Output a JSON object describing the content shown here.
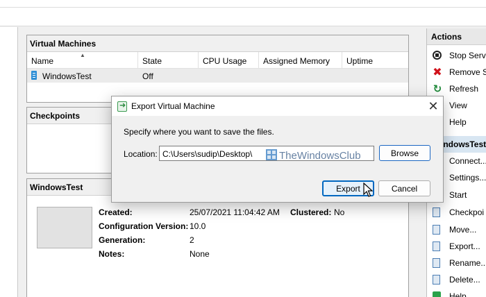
{
  "vm_panel": {
    "title": "Virtual Machines",
    "columns": [
      "Name",
      "State",
      "CPU Usage",
      "Assigned Memory",
      "Uptime"
    ],
    "rows": [
      {
        "name": "WindowsTest",
        "state": "Off",
        "cpu": "",
        "memory": "",
        "uptime": ""
      }
    ]
  },
  "checkpoints_panel": {
    "title": "Checkpoints"
  },
  "details_panel": {
    "title": "WindowsTest",
    "fields": [
      {
        "label": "Created:",
        "value": "25/07/2021 11:04:42 AM"
      },
      {
        "label": "Configuration Version:",
        "value": "10.0"
      },
      {
        "label": "Generation:",
        "value": "2"
      },
      {
        "label": "Notes:",
        "value": "None"
      }
    ],
    "clustered": {
      "label": "Clustered:",
      "value": "No"
    }
  },
  "actions": {
    "title": "Actions",
    "items": [
      {
        "label": "Stop Servi",
        "icon": "stop-service-icon"
      },
      {
        "label": "Remove S",
        "icon": "remove-icon"
      },
      {
        "label": "Refresh",
        "icon": "refresh-icon"
      },
      {
        "label": "View",
        "icon": ""
      },
      {
        "label": "Help",
        "icon": ""
      }
    ],
    "vm_section": "indowsTest",
    "vm_items": [
      {
        "label": "Connect...",
        "icon": ""
      },
      {
        "label": "Settings...",
        "icon": ""
      },
      {
        "label": "Start",
        "icon": ""
      },
      {
        "label": "Checkpoi",
        "icon": "checkpoint-icon"
      },
      {
        "label": "Move...",
        "icon": "move-icon"
      },
      {
        "label": "Export...",
        "icon": "export-icon"
      },
      {
        "label": "Rename...",
        "icon": "rename-icon"
      },
      {
        "label": "Delete...",
        "icon": "delete-icon"
      },
      {
        "label": "Help",
        "icon": "help-icon"
      }
    ]
  },
  "dialog": {
    "title": "Export Virtual Machine",
    "prompt": "Specify where you want to save the files.",
    "location_label": "Location:",
    "location_value": "C:\\Users\\sudip\\Desktop\\",
    "watermark": "TheWindowsClub",
    "browse_label": "Browse",
    "export_label": "Export",
    "cancel_label": "Cancel",
    "close_glyph": "✕"
  }
}
